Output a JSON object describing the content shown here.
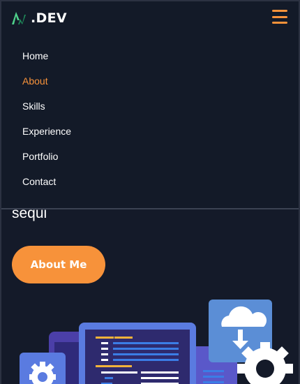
{
  "brand": {
    "text": ".DEV",
    "logo_icon": "logo-mark-icon",
    "colors": {
      "accent": "#f7923a",
      "logo_green": "#4fd18b",
      "logo_dark": "#1f8a5a"
    }
  },
  "menu": {
    "toggle_icon": "hamburger-menu-icon",
    "items": [
      {
        "label": "Home",
        "active": false
      },
      {
        "label": "About",
        "active": true
      },
      {
        "label": "Skills",
        "active": false
      },
      {
        "label": "Experience",
        "active": false
      },
      {
        "label": "Portfolio",
        "active": false
      },
      {
        "label": "Contact",
        "active": false
      }
    ]
  },
  "hero": {
    "text": "sequi",
    "button_label": "About Me"
  },
  "illustration": {
    "icons": [
      "gear-icon",
      "cloud-download-icon",
      "code-editor-window-icon",
      "gear-icon"
    ]
  },
  "theme": {
    "background": "#141a29",
    "accent": "#f7923a",
    "text": "#ffffff"
  }
}
